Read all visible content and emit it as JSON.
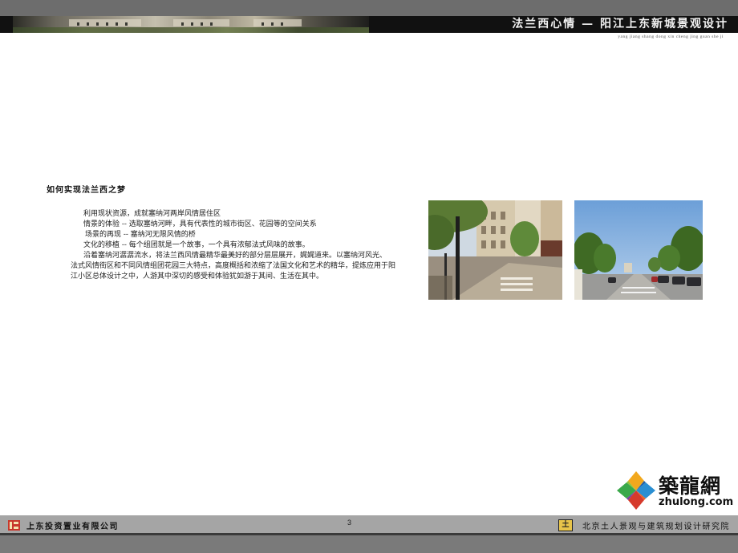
{
  "header": {
    "title": "法兰西心情 — 阳江上东新城景观设计",
    "pinyin": "yang  jiang shang dong xin cheng jing guan she ji"
  },
  "main": {
    "heading": "如何实现法兰西之梦",
    "paragraphs": [
      [
        "利用现状资源，成就塞纳河两岸风情居住区"
      ],
      [
        "情景的体验 -- 选取塞纳河畔，具有代表性的城市街区、花园等的空间关系"
      ],
      [
        "场景的再现 -- 塞纳河无限风情的桥"
      ],
      [
        "文化的移植 -- 每个组团就是一个故事，一个具有浓郁法式风味的故事。"
      ],
      [
        "沿着塞纳河潺潺流水，将法兰西风情最精华最美好的部分层层展开，娓娓道来。以塞纳河风光、",
        "法式风情街区和不同风情组团花园三大特点，高度概括和浓缩了法国文化和艺术的精华，提炼应用于阳",
        "江小区总体设计之中，人游其中深切的感受和体验犹如游于其间、生活在其中。"
      ]
    ]
  },
  "logo": {
    "cn": "築龍網",
    "en": "zhulong.com"
  },
  "footer": {
    "left_company": "上东投资置业有限公司",
    "page_number": "3",
    "right_company": "北京土人景观与建筑规划设计研究院",
    "right_mark": "土"
  }
}
